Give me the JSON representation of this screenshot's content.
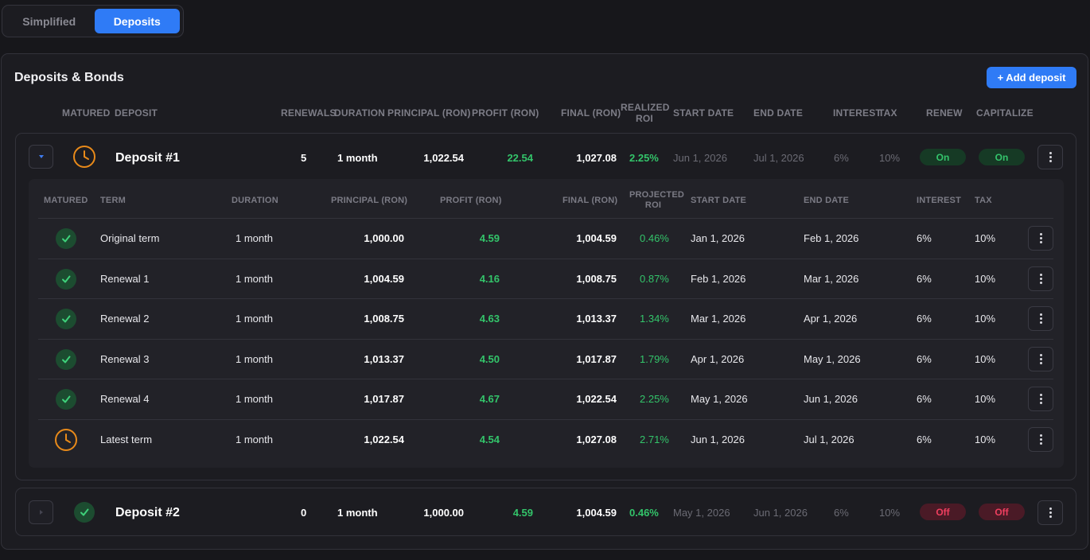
{
  "tabs": {
    "simplified": "Simplified",
    "deposits": "Deposits"
  },
  "card": {
    "title": "Deposits & Bonds",
    "add_label": "+ Add deposit"
  },
  "headers": {
    "matured": "MATURED",
    "deposit": "DEPOSIT",
    "renewals": "RENEWALS",
    "duration": "DURATION",
    "principal": "PRINCIPAL (RON)",
    "profit": "PROFIT (RON)",
    "final": "FINAL (RON)",
    "realized_roi": "REALIZED ROI",
    "start_date": "START DATE",
    "end_date": "END DATE",
    "interest": "INTEREST",
    "tax": "TAX",
    "renew": "RENEW",
    "capitalize": "CAPITALIZE"
  },
  "inner_headers": {
    "matured": "MATURED",
    "term": "TERM",
    "duration": "DURATION",
    "principal": "PRINCIPAL (RON)",
    "profit": "PROFIT (RON)",
    "final": "FINAL (RON)",
    "projected_roi": "PROJECTED ROI",
    "start_date": "START DATE",
    "end_date": "END DATE",
    "interest": "INTEREST",
    "tax": "TAX"
  },
  "deposits": [
    {
      "name": "Deposit #1",
      "renewals": "5",
      "duration": "1 month",
      "principal": "1,022.54",
      "profit": "22.54",
      "final": "1,027.08",
      "roi": "2.25%",
      "start": "Jun 1, 2026",
      "end": "Jul 1, 2026",
      "interest": "6%",
      "tax": "10%",
      "renew": "On",
      "capitalize": "On",
      "status_icon": "clock-icon",
      "terms": [
        {
          "term": "Original term",
          "duration": "1 month",
          "principal": "1,000.00",
          "profit": "4.59",
          "final": "1,004.59",
          "roi": "0.46%",
          "start": "Jan 1, 2026",
          "end": "Feb 1, 2026",
          "interest": "6%",
          "tax": "10%",
          "status": "check"
        },
        {
          "term": "Renewal 1",
          "duration": "1 month",
          "principal": "1,004.59",
          "profit": "4.16",
          "final": "1,008.75",
          "roi": "0.87%",
          "start": "Feb 1, 2026",
          "end": "Mar 1, 2026",
          "interest": "6%",
          "tax": "10%",
          "status": "check"
        },
        {
          "term": "Renewal 2",
          "duration": "1 month",
          "principal": "1,008.75",
          "profit": "4.63",
          "final": "1,013.37",
          "roi": "1.34%",
          "start": "Mar 1, 2026",
          "end": "Apr 1, 2026",
          "interest": "6%",
          "tax": "10%",
          "status": "check"
        },
        {
          "term": "Renewal 3",
          "duration": "1 month",
          "principal": "1,013.37",
          "profit": "4.50",
          "final": "1,017.87",
          "roi": "1.79%",
          "start": "Apr 1, 2026",
          "end": "May 1, 2026",
          "interest": "6%",
          "tax": "10%",
          "status": "check"
        },
        {
          "term": "Renewal 4",
          "duration": "1 month",
          "principal": "1,017.87",
          "profit": "4.67",
          "final": "1,022.54",
          "roi": "2.25%",
          "start": "May 1, 2026",
          "end": "Jun 1, 2026",
          "interest": "6%",
          "tax": "10%",
          "status": "check"
        },
        {
          "term": "Latest term",
          "duration": "1 month",
          "principal": "1,022.54",
          "profit": "4.54",
          "final": "1,027.08",
          "roi": "2.71%",
          "start": "Jun 1, 2026",
          "end": "Jul 1, 2026",
          "interest": "6%",
          "tax": "10%",
          "status": "clock"
        }
      ]
    },
    {
      "name": "Deposit #2",
      "renewals": "0",
      "duration": "1 month",
      "principal": "1,000.00",
      "profit": "4.59",
      "final": "1,004.59",
      "roi": "0.46%",
      "start": "May 1, 2026",
      "end": "Jun 1, 2026",
      "interest": "6%",
      "tax": "10%",
      "renew": "Off",
      "capitalize": "Off",
      "status_icon": "check-icon"
    }
  ],
  "colors": {
    "accent": "#2f7bf6",
    "green": "#33c46a",
    "orange": "#e88a1a",
    "red": "#ef3f5f"
  }
}
